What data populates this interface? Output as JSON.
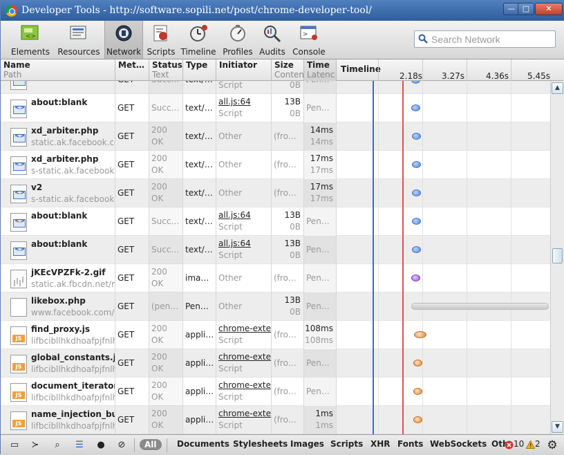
{
  "window": {
    "title": "Developer Tools - http://software.sopili.net/post/chrome-developer-tool/",
    "minimize_label": "—",
    "maximize_label": "□",
    "close_label": "✕"
  },
  "toolbar": {
    "tabs": [
      {
        "label": "Elements"
      },
      {
        "label": "Resources"
      },
      {
        "label": "Network"
      },
      {
        "label": "Scripts"
      },
      {
        "label": "Timeline"
      },
      {
        "label": "Profiles"
      },
      {
        "label": "Audits"
      },
      {
        "label": "Console"
      }
    ],
    "active_tab": "Network",
    "search_placeholder": "Search Network"
  },
  "grid": {
    "headers": {
      "name": "Name",
      "name_sub": "Path",
      "method": "Met…",
      "status": "Status",
      "status_sub": "Text",
      "type": "Type",
      "initiator": "Initiator",
      "size": "Size",
      "size_sub": "Conten",
      "time": "Time",
      "time_sub": "Latenc",
      "timeline": "Timeline"
    },
    "ticks": [
      "2.18s",
      "3.27s",
      "4.36s",
      "5.45s"
    ],
    "rows": [
      {
        "name": "",
        "path": "",
        "method": "GET",
        "status": "Succ…",
        "status_text": "",
        "type": "text/…",
        "initiator": "",
        "initiator_sub": "Script",
        "initiator_link": false,
        "size": "",
        "content": "0B",
        "time": "Pen…",
        "latency": "",
        "icon": "doc"
      },
      {
        "name": "about:blank",
        "path": "",
        "method": "GET",
        "status": "Succ…",
        "status_text": "",
        "type": "text/…",
        "initiator": "all.js:64",
        "initiator_sub": "Script",
        "initiator_link": true,
        "size": "13B",
        "content": "0B",
        "time": "Pen…",
        "latency": "",
        "icon": "doc"
      },
      {
        "name": "xd_arbiter.php",
        "path": "static.ak.facebook.com",
        "method": "GET",
        "status": "200",
        "status_text": "OK",
        "type": "text/…",
        "initiator": "Other",
        "initiator_sub": "",
        "initiator_link": false,
        "size": "(fro…",
        "content": "",
        "time": "14ms",
        "latency": "14ms",
        "icon": "doc"
      },
      {
        "name": "xd_arbiter.php",
        "path": "s-static.ak.facebook.c",
        "method": "GET",
        "status": "200",
        "status_text": "OK",
        "type": "text/…",
        "initiator": "Other",
        "initiator_sub": "",
        "initiator_link": false,
        "size": "(fro…",
        "content": "",
        "time": "17ms",
        "latency": "17ms",
        "icon": "doc"
      },
      {
        "name": "v2",
        "path": "s-static.ak.facebook.c",
        "method": "GET",
        "status": "200",
        "status_text": "OK",
        "type": "text/…",
        "initiator": "Other",
        "initiator_sub": "",
        "initiator_link": false,
        "size": "(fro…",
        "content": "",
        "time": "17ms",
        "latency": "17ms",
        "icon": "doc"
      },
      {
        "name": "about:blank",
        "path": "",
        "method": "GET",
        "status": "Succ…",
        "status_text": "",
        "type": "text/…",
        "initiator": "all.js:64",
        "initiator_sub": "Script",
        "initiator_link": true,
        "size": "13B",
        "content": "0B",
        "time": "Pen…",
        "latency": "",
        "icon": "doc"
      },
      {
        "name": "about:blank",
        "path": "",
        "method": "GET",
        "status": "Succ…",
        "status_text": "",
        "type": "text/…",
        "initiator": "all.js:64",
        "initiator_sub": "Script",
        "initiator_link": true,
        "size": "13B",
        "content": "0B",
        "time": "Pen…",
        "latency": "",
        "icon": "doc"
      },
      {
        "name": "jKEcVPZFk-2.gif",
        "path": "static.ak.fbcdn.net/rsr",
        "method": "GET",
        "status": "200",
        "status_text": "OK",
        "type": "ima…",
        "initiator": "Other",
        "initiator_sub": "",
        "initiator_link": false,
        "size": "(fro…",
        "content": "",
        "time": "Pen…",
        "latency": "",
        "icon": "img"
      },
      {
        "name": "likebox.php",
        "path": "www.facebook.com/p",
        "method": "GET",
        "status": "(pen…",
        "status_text": "",
        "type": "Pen…",
        "initiator": "Other",
        "initiator_sub": "",
        "initiator_link": false,
        "size": "13B",
        "content": "0B",
        "time": "Pen…",
        "latency": "",
        "icon": "blank"
      },
      {
        "name": "find_proxy.js",
        "path": "lifbcibllhkdhoafpjfnlhf",
        "method": "GET",
        "status": "200",
        "status_text": "OK",
        "type": "appli…",
        "initiator": "chrome-exter",
        "initiator_sub": "Script",
        "initiator_link": true,
        "size": "(fro…",
        "content": "",
        "time": "108ms",
        "latency": "108ms",
        "icon": "js"
      },
      {
        "name": "global_constants.js",
        "path": "lifbcibllhkdhoafpjfnlhf",
        "method": "GET",
        "status": "200",
        "status_text": "OK",
        "type": "appli…",
        "initiator": "chrome-exter",
        "initiator_sub": "Script",
        "initiator_link": true,
        "size": "(fro…",
        "content": "",
        "time": "Pen…",
        "latency": "",
        "icon": "js"
      },
      {
        "name": "document_iterator.js",
        "path": "lifbcibllhkdhoafpjfnlhf",
        "method": "GET",
        "status": "200",
        "status_text": "OK",
        "type": "appli…",
        "initiator": "chrome-exter",
        "initiator_sub": "Script",
        "initiator_link": true,
        "size": "(fro…",
        "content": "",
        "time": "Pen…",
        "latency": "",
        "icon": "js"
      },
      {
        "name": "name_injection_build",
        "path": "lifbcibllhkdhoafpjfnlhf",
        "method": "GET",
        "status": "200",
        "status_text": "OK",
        "type": "appli…",
        "initiator": "chrome-exter",
        "initiator_sub": "Script",
        "initiator_link": true,
        "size": "(fro…",
        "content": "",
        "time": "1ms",
        "latency": "1ms",
        "icon": "js"
      }
    ]
  },
  "statusbar": {
    "all_label": "All",
    "filters": [
      "Documents",
      "Stylesheets",
      "Images",
      "Scripts",
      "XHR",
      "Fonts",
      "WebSockets",
      "Oth"
    ],
    "errors": "10",
    "warnings": "2"
  }
}
